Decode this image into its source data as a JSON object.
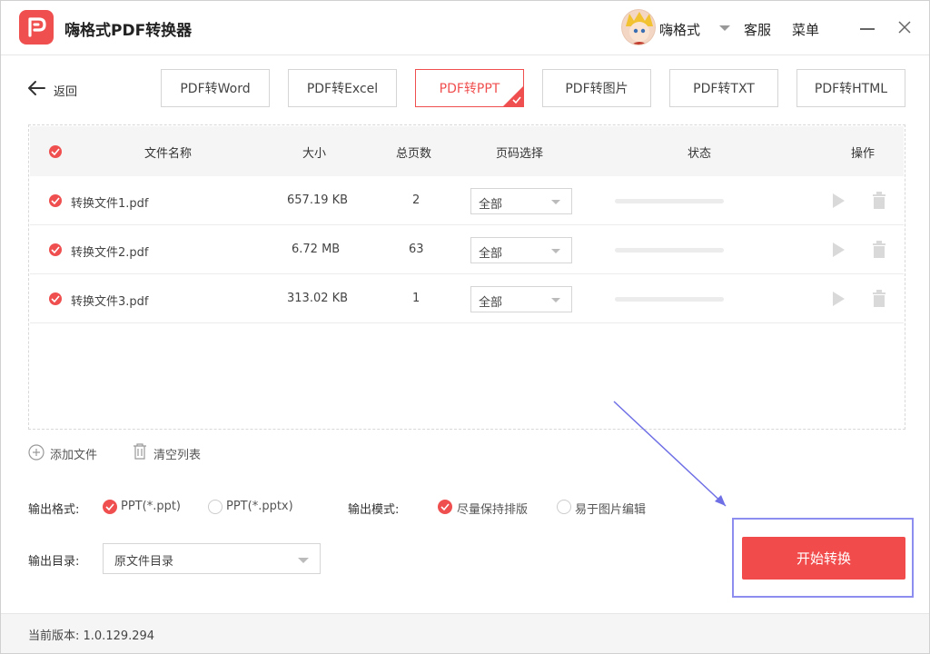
{
  "app": {
    "title": "嗨格式PDF转换器",
    "username": "嗨格式",
    "service_label": "客服",
    "menu_label": "菜单",
    "accent_color": "#f04f4f"
  },
  "nav": {
    "back_label": "返回",
    "tabs": [
      {
        "label": "PDF转Word",
        "active": false
      },
      {
        "label": "PDF转Excel",
        "active": false
      },
      {
        "label": "PDF转PPT",
        "active": true
      },
      {
        "label": "PDF转图片",
        "active": false
      },
      {
        "label": "PDF转TXT",
        "active": false
      },
      {
        "label": "PDF转HTML",
        "active": false
      }
    ]
  },
  "table": {
    "headers": {
      "name": "文件名称",
      "size": "大小",
      "pages": "总页数",
      "page_select": "页码选择",
      "status": "状态",
      "actions": "操作"
    },
    "rows": [
      {
        "name": "转换文件1.pdf",
        "size": "657.19 KB",
        "pages": "2",
        "page_select": "全部",
        "progress": 0
      },
      {
        "name": "转换文件2.pdf",
        "size": "6.72 MB",
        "pages": "63",
        "page_select": "全部",
        "progress": 0
      },
      {
        "name": "转换文件3.pdf",
        "size": "313.02 KB",
        "pages": "1",
        "page_select": "全部",
        "progress": 0
      }
    ]
  },
  "actions": {
    "add_file": "添加文件",
    "clear_list": "清空列表"
  },
  "output": {
    "format_label": "输出格式:",
    "format_options": [
      {
        "label": "PPT(*.ppt)",
        "selected": true
      },
      {
        "label": "PPT(*.pptx)",
        "selected": false
      }
    ],
    "mode_label": "输出模式:",
    "mode_options": [
      {
        "label": "尽量保持排版",
        "selected": true
      },
      {
        "label": "易于图片编辑",
        "selected": false
      }
    ],
    "dir_label": "输出目录:",
    "dir_value": "原文件目录"
  },
  "start_button": "开始转换",
  "footer": {
    "version": "当前版本: 1.0.129.294"
  }
}
